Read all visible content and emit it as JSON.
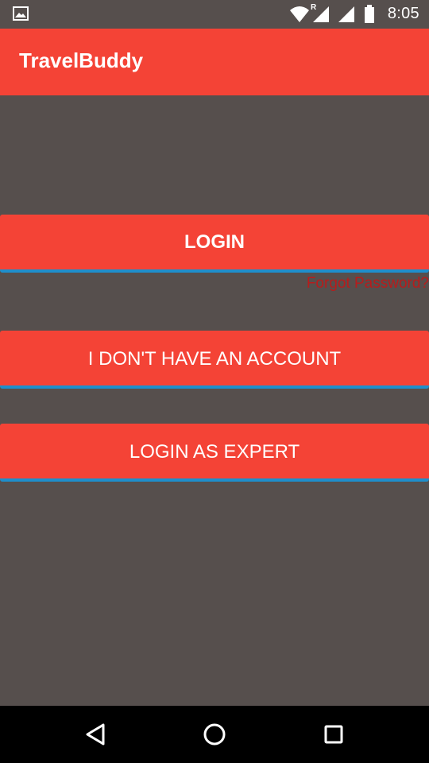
{
  "status_bar": {
    "time": "8:05",
    "icons": [
      "image-notification-icon",
      "wifi-icon",
      "roaming-signal-icon",
      "cell-signal-icon",
      "battery-icon"
    ],
    "roaming_label": "R"
  },
  "app_bar": {
    "title": "TravelBuddy"
  },
  "main": {
    "login_label": "LOGIN",
    "forgot_password_label": "Forgot Password?",
    "signup_label": "I DON'T HAVE AN ACCOUNT",
    "expert_label": "LOGIN AS EXPERT"
  },
  "nav_bar": {
    "icons": [
      "back-icon",
      "home-icon",
      "recents-icon"
    ]
  },
  "colors": {
    "primary": "#f44336",
    "background": "#564f4d",
    "accent_underline": "#1e8fcc",
    "link": "#b71c1c"
  }
}
